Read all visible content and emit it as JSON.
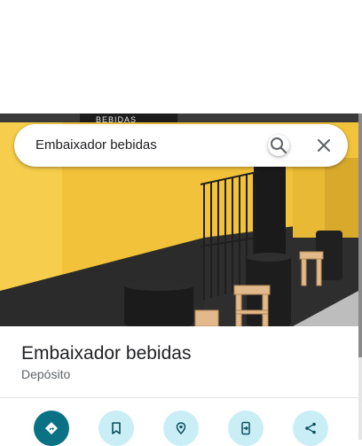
{
  "search": {
    "value": "Embaixador bebidas",
    "icons": {
      "search": "search-icon",
      "clear": "close-icon"
    }
  },
  "place": {
    "name": "Embaixador bebidas",
    "category": "Depósito",
    "photo_sign_text": "BEBIDAS"
  },
  "actions": [
    {
      "icon": "directions-icon"
    },
    {
      "icon": "bookmark-icon"
    },
    {
      "icon": "nearby-icon"
    },
    {
      "icon": "send-to-phone-icon"
    },
    {
      "icon": "share-icon"
    }
  ],
  "colors": {
    "primary_action": "#0b7285",
    "secondary_action": "#c9eef6",
    "wall_yellow": "#f2c23a",
    "wall_black": "#2b2b2b"
  }
}
